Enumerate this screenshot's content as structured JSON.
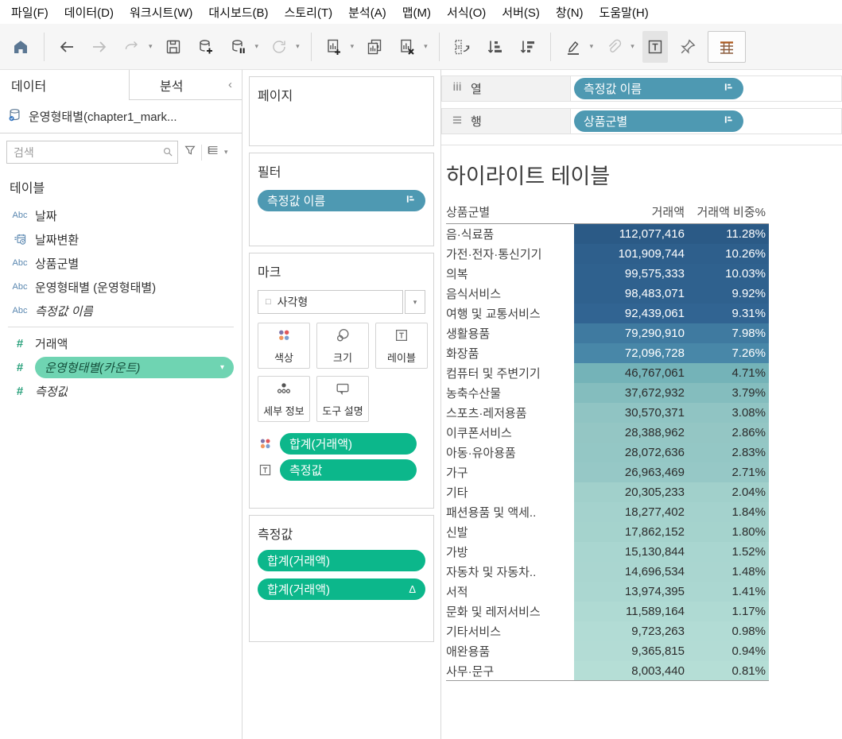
{
  "menu": {
    "items": [
      "파일(F)",
      "데이터(D)",
      "워크시트(W)",
      "대시보드(B)",
      "스토리(T)",
      "분석(A)",
      "맵(M)",
      "서식(O)",
      "서버(S)",
      "창(N)",
      "도움말(H)"
    ]
  },
  "toolbar": {
    "buttons": [
      {
        "name": "home",
        "icon": "home-icon",
        "enabled": true
      },
      {
        "sep": true
      },
      {
        "name": "back",
        "icon": "arrow-left-icon",
        "enabled": true
      },
      {
        "name": "forward",
        "icon": "arrow-right-icon",
        "enabled": false
      },
      {
        "name": "redo",
        "icon": "redo-icon",
        "enabled": false,
        "caret": true
      },
      {
        "name": "save",
        "icon": "save-icon",
        "enabled": true
      },
      {
        "name": "new-data-source",
        "icon": "datasource-add-icon",
        "enabled": true
      },
      {
        "name": "pause-auto-updates",
        "icon": "datasource-pause-icon",
        "enabled": true,
        "caret": true
      },
      {
        "name": "run-update",
        "icon": "refresh-icon",
        "enabled": false,
        "caret": true
      },
      {
        "sep": true
      },
      {
        "name": "new-worksheet",
        "icon": "worksheet-add-icon",
        "enabled": true,
        "caret": true
      },
      {
        "name": "duplicate-sheet",
        "icon": "duplicate-icon",
        "enabled": true
      },
      {
        "name": "clear-sheet",
        "icon": "clear-sheet-icon",
        "enabled": true,
        "caret": true
      },
      {
        "sep": true
      },
      {
        "name": "swap-rows-columns",
        "icon": "swap-icon",
        "enabled": true
      },
      {
        "name": "sort-ascending",
        "icon": "sort-asc-icon",
        "enabled": true
      },
      {
        "name": "sort-descending",
        "icon": "sort-desc-icon",
        "enabled": true
      },
      {
        "sep": true
      },
      {
        "name": "highlight",
        "icon": "highlight-icon",
        "enabled": true,
        "caret": true
      },
      {
        "name": "group-members",
        "icon": "paperclip-icon",
        "enabled": false,
        "caret": true
      },
      {
        "name": "show-mark-labels",
        "icon": "text-label-icon",
        "enabled": true,
        "pressed": true
      },
      {
        "name": "fix-axes",
        "icon": "pin-icon",
        "enabled": true
      },
      {
        "name": "fit",
        "icon": "fit-table-icon",
        "enabled": true,
        "boxed": true
      }
    ]
  },
  "data_pane": {
    "tab_data": "데이터",
    "tab_analytics": "분석",
    "collapse_chevron": "‹",
    "datasource": "운영형태별(chapter1_mark...",
    "search_placeholder": "검색",
    "section": "테이블",
    "fields": [
      {
        "icon": "abc-icon",
        "label": "날짜",
        "italic": false
      },
      {
        "icon": "date-calc-icon",
        "label": "날짜변환",
        "italic": false
      },
      {
        "icon": "abc-icon",
        "label": "상품군별",
        "italic": false
      },
      {
        "icon": "abc-icon",
        "label": "운영형태별 (운영형태별)",
        "italic": false
      },
      {
        "icon": "abc-icon",
        "label": "측정값 이름",
        "italic": true,
        "divider_after": true
      },
      {
        "icon": "hash-icon",
        "label": "거래액",
        "italic": false
      },
      {
        "icon": "hash-icon",
        "label": "운영형태별(카운트)",
        "italic": true,
        "pill": true
      },
      {
        "icon": "hash-icon",
        "label": "측정값",
        "italic": true
      }
    ]
  },
  "shelf_pane": {
    "pages_label": "페이지",
    "filters_label": "필터",
    "filter_pills": [
      {
        "label": "측정값 이름"
      }
    ],
    "marks_label": "마크",
    "mark_type": "사각형",
    "mark_buttons": [
      {
        "name": "color",
        "icon": "color-icon",
        "label": "색상"
      },
      {
        "name": "size",
        "icon": "size-icon",
        "label": "크기"
      },
      {
        "name": "label",
        "icon": "label-icon",
        "label": "레이블"
      },
      {
        "name": "detail",
        "icon": "detail-icon",
        "label": "세부 정보"
      },
      {
        "name": "tooltip",
        "icon": "tooltip-icon",
        "label": "도구 설명"
      }
    ],
    "mark_pills": [
      {
        "icon": "color-icon",
        "label": "합계(거래액)"
      },
      {
        "icon": "label-icon",
        "label": "측정값"
      }
    ],
    "measure_values_label": "측정값",
    "measure_pills": [
      {
        "label": "합계(거래액)"
      },
      {
        "label": "합계(거래액)",
        "badge": "Δ"
      }
    ]
  },
  "view": {
    "columns_shelf_label": "열",
    "columns_pills": [
      {
        "label": "측정값 이름"
      }
    ],
    "rows_shelf_label": "행",
    "rows_pills": [
      {
        "label": "상품군별"
      }
    ]
  },
  "chart_data": {
    "type": "heatmap",
    "title": "하이라이트 테이블",
    "columns": [
      "상품군별",
      "거래액",
      "거래액 비중%"
    ],
    "rows": [
      {
        "label": "음·식료품",
        "value": 112077416,
        "value_text": "112,077,416",
        "pct": "11.28%"
      },
      {
        "label": "가전·전자·통신기기",
        "value": 101909744,
        "value_text": "101,909,744",
        "pct": "10.26%"
      },
      {
        "label": "의복",
        "value": 99575333,
        "value_text": "99,575,333",
        "pct": "10.03%"
      },
      {
        "label": "음식서비스",
        "value": 98483071,
        "value_text": "98,483,071",
        "pct": "9.92%"
      },
      {
        "label": "여행 및 교통서비스",
        "value": 92439061,
        "value_text": "92,439,061",
        "pct": "9.31%"
      },
      {
        "label": "생활용품",
        "value": 79290910,
        "value_text": "79,290,910",
        "pct": "7.98%"
      },
      {
        "label": "화장품",
        "value": 72096728,
        "value_text": "72,096,728",
        "pct": "7.26%"
      },
      {
        "label": "컴퓨터 및 주변기기",
        "value": 46767061,
        "value_text": "46,767,061",
        "pct": "4.71%"
      },
      {
        "label": "농축수산물",
        "value": 37672932,
        "value_text": "37,672,932",
        "pct": "3.79%"
      },
      {
        "label": "스포츠·레저용품",
        "value": 30570371,
        "value_text": "30,570,371",
        "pct": "3.08%"
      },
      {
        "label": "이쿠폰서비스",
        "value": 28388962,
        "value_text": "28,388,962",
        "pct": "2.86%"
      },
      {
        "label": "아동·유아용품",
        "value": 28072636,
        "value_text": "28,072,636",
        "pct": "2.83%"
      },
      {
        "label": "가구",
        "value": 26963469,
        "value_text": "26,963,469",
        "pct": "2.71%"
      },
      {
        "label": "기타",
        "value": 20305233,
        "value_text": "20,305,233",
        "pct": "2.04%"
      },
      {
        "label": "패션용품 및 액세..",
        "value": 18277402,
        "value_text": "18,277,402",
        "pct": "1.84%"
      },
      {
        "label": "신발",
        "value": 17862152,
        "value_text": "17,862,152",
        "pct": "1.80%"
      },
      {
        "label": "가방",
        "value": 15130844,
        "value_text": "15,130,844",
        "pct": "1.52%"
      },
      {
        "label": "자동차 및 자동차..",
        "value": 14696534,
        "value_text": "14,696,534",
        "pct": "1.48%"
      },
      {
        "label": "서적",
        "value": 13974395,
        "value_text": "13,974,395",
        "pct": "1.41%"
      },
      {
        "label": "문화 및 레저서비스",
        "value": 11589164,
        "value_text": "11,589,164",
        "pct": "1.17%"
      },
      {
        "label": "기타서비스",
        "value": 9723263,
        "value_text": "9,723,263",
        "pct": "0.98%"
      },
      {
        "label": "애완용품",
        "value": 9365815,
        "value_text": "9,365,815",
        "pct": "0.94%"
      },
      {
        "label": "사무·문구",
        "value": 8003440,
        "value_text": "8,003,440",
        "pct": "0.81%"
      }
    ],
    "color_scale": {
      "min": 8003440,
      "max": 112077416,
      "stops": [
        "#b5ded6",
        "#93c6c4",
        "#6fb0b6",
        "#4a8aaa",
        "#316593",
        "#2b5a86"
      ],
      "light_text_threshold": 0.5,
      "light_text_color": "#ffffff",
      "dark_text_color": "#2b2b2b"
    },
    "legend_position": "none",
    "grid": false
  },
  "colors": {
    "pill_blue": "#4e99b2",
    "pill_green": "#0cb78b",
    "field_pill_green": "#6fd4b2",
    "toolbar_bg": "#f6f6f6",
    "home_icon_blue": "#5b7793"
  }
}
